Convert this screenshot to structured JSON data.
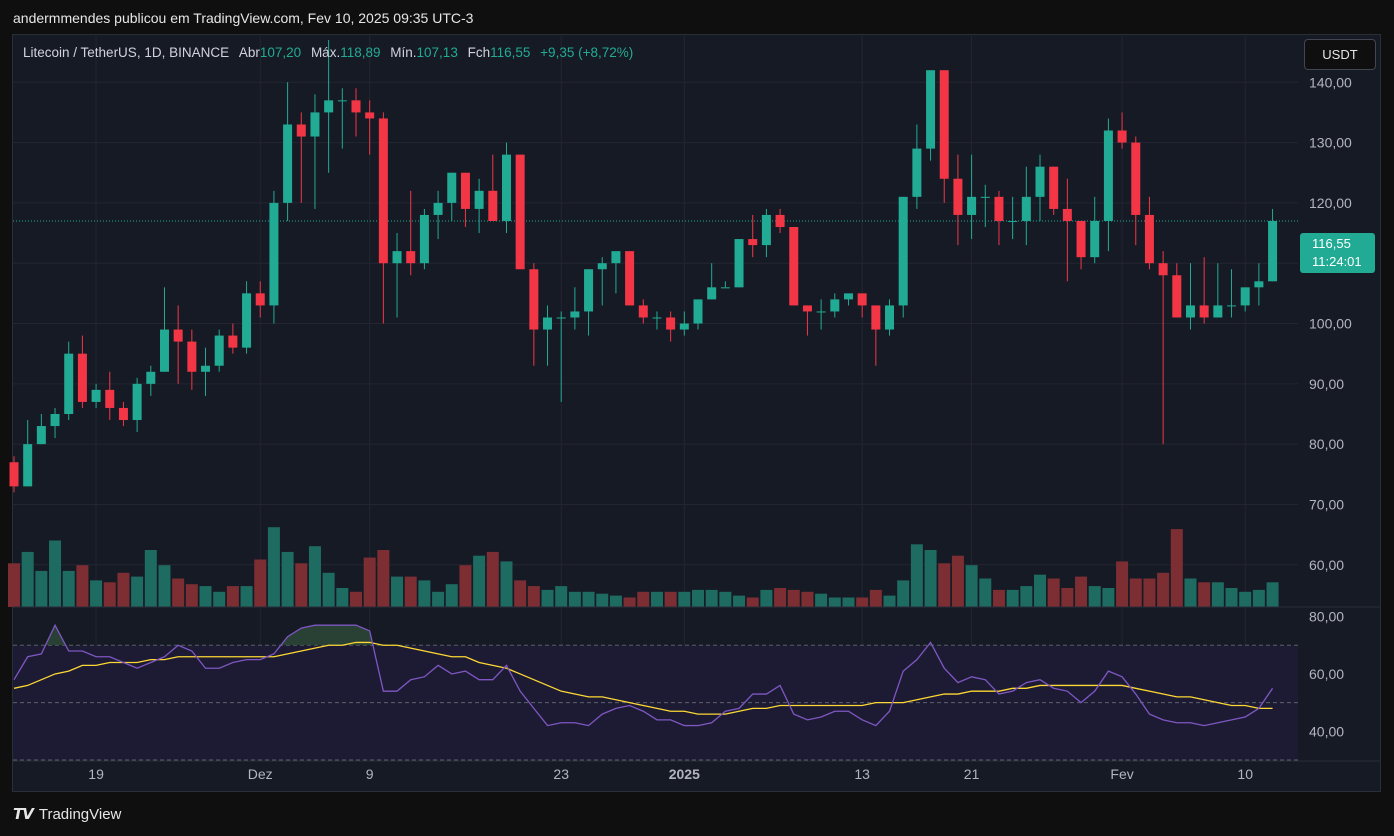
{
  "header": {
    "text": "andermmendes publicou em TradingView.com, Fev 10, 2025 09:35 UTC-3"
  },
  "legend": {
    "symbol": "Litecoin / TetherUS, 1D, BINANCE",
    "open_label": "Abr",
    "open": "107,20",
    "high_label": "Máx.",
    "high": "118,89",
    "low_label": "Mín.",
    "low": "107,13",
    "close_label": "Fch",
    "close": "116,55",
    "change": "+9,35 (+8,72%)"
  },
  "currency_button": "USDT",
  "price_tag": {
    "price": "116,55",
    "countdown": "11:24:01"
  },
  "footer": {
    "brand": "TradingView",
    "logo": "tradingview-logo-icon"
  },
  "colors": {
    "up": "#22ab94",
    "down": "#f23645",
    "up_volume": "#1e6b62",
    "down_volume": "#7d2e33",
    "rsi": "#7e57c2",
    "rsi_ma": "#fdd835"
  },
  "chart_data": {
    "type": "candlestick",
    "price_ylim": [
      53,
      148
    ],
    "price_ticks": [
      "140,00",
      "130,00",
      "120,00",
      "110,00",
      "100,00",
      "90,00",
      "80,00",
      "70,00",
      "60,00"
    ],
    "price_tick_values": [
      140,
      130,
      120,
      110,
      100,
      90,
      80,
      70,
      60
    ],
    "rsi_ylim": [
      30,
      83
    ],
    "rsi_ticks": [
      "80,00",
      "60,00",
      "40,00"
    ],
    "rsi_tick_values": [
      80,
      60,
      40
    ],
    "rsi_bands": [
      70,
      50,
      30
    ],
    "x_labels": [
      {
        "index": 6,
        "text": "19",
        "bold": false
      },
      {
        "index": 18,
        "text": "Dez",
        "bold": false
      },
      {
        "index": 26,
        "text": "9",
        "bold": false
      },
      {
        "index": 40,
        "text": "23",
        "bold": false
      },
      {
        "index": 49,
        "text": "2025",
        "bold": true
      },
      {
        "index": 62,
        "text": "13",
        "bold": false
      },
      {
        "index": 70,
        "text": "21",
        "bold": false
      },
      {
        "index": 81,
        "text": "Fev",
        "bold": false
      },
      {
        "index": 90,
        "text": "10",
        "bold": false
      }
    ],
    "grid": true,
    "candles": [
      [
        77,
        78,
        72,
        73
      ],
      [
        73,
        84,
        73,
        80
      ],
      [
        80,
        85,
        80,
        83
      ],
      [
        83,
        86,
        81,
        85
      ],
      [
        85,
        97,
        84,
        95
      ],
      [
        95,
        98,
        86,
        87
      ],
      [
        87,
        90,
        86,
        89
      ],
      [
        89,
        92,
        84,
        86
      ],
      [
        86,
        87,
        83,
        84
      ],
      [
        84,
        91,
        82,
        90
      ],
      [
        90,
        93,
        88,
        92
      ],
      [
        92,
        106,
        92,
        99
      ],
      [
        99,
        103,
        90,
        97
      ],
      [
        97,
        99,
        89,
        92
      ],
      [
        92,
        96,
        88,
        93
      ],
      [
        93,
        99,
        92,
        98
      ],
      [
        98,
        100,
        95,
        96
      ],
      [
        96,
        107,
        95,
        105
      ],
      [
        105,
        107,
        101,
        103
      ],
      [
        103,
        122,
        100,
        120
      ],
      [
        120,
        140,
        117,
        133
      ],
      [
        133,
        135,
        120,
        131
      ],
      [
        131,
        138,
        119,
        135
      ],
      [
        135,
        147,
        125,
        137
      ],
      [
        137,
        139,
        129,
        137
      ],
      [
        137,
        139,
        131,
        135
      ],
      [
        135,
        137,
        128,
        134
      ],
      [
        134,
        135,
        100,
        110
      ],
      [
        110,
        115,
        101,
        112
      ],
      [
        112,
        122,
        108,
        110
      ],
      [
        110,
        119,
        109,
        118
      ],
      [
        118,
        122,
        114,
        120
      ],
      [
        120,
        125,
        117,
        125
      ],
      [
        125,
        125,
        116,
        119
      ],
      [
        119,
        124,
        115,
        122
      ],
      [
        122,
        128,
        117,
        117
      ],
      [
        117,
        130,
        115,
        128
      ],
      [
        128,
        128,
        109,
        109
      ],
      [
        109,
        110,
        93,
        99
      ],
      [
        99,
        103,
        93,
        101
      ],
      [
        101,
        102,
        87,
        101
      ],
      [
        101,
        106,
        99,
        102
      ],
      [
        102,
        109,
        98,
        109
      ],
      [
        109,
        111,
        103,
        110
      ],
      [
        110,
        111,
        105,
        112
      ],
      [
        112,
        112,
        103,
        103
      ],
      [
        103,
        104,
        100,
        101
      ],
      [
        101,
        102,
        99,
        101
      ],
      [
        101,
        102,
        97,
        99
      ],
      [
        99,
        102,
        98,
        100
      ],
      [
        100,
        103,
        99,
        104
      ],
      [
        104,
        110,
        104,
        106
      ],
      [
        106,
        107,
        106,
        106
      ],
      [
        106,
        113,
        106,
        114
      ],
      [
        114,
        118,
        111,
        113
      ],
      [
        113,
        119,
        111,
        118
      ],
      [
        118,
        119,
        115,
        116
      ],
      [
        116,
        116,
        103,
        103
      ],
      [
        103,
        103,
        98,
        102
      ],
      [
        102,
        104,
        99,
        102
      ],
      [
        102,
        105,
        101,
        104
      ],
      [
        104,
        105,
        103,
        105
      ],
      [
        105,
        105,
        101,
        103
      ],
      [
        103,
        103,
        93,
        99
      ],
      [
        99,
        104,
        98,
        103
      ],
      [
        103,
        121,
        101,
        121
      ],
      [
        121,
        133,
        119,
        129
      ],
      [
        129,
        141,
        127,
        142
      ],
      [
        142,
        140,
        120,
        124
      ],
      [
        124,
        128,
        113,
        118
      ],
      [
        118,
        128,
        114,
        121
      ],
      [
        121,
        123,
        116,
        121
      ],
      [
        121,
        122,
        113,
        117
      ],
      [
        117,
        121,
        114,
        117
      ],
      [
        117,
        126,
        113,
        121
      ],
      [
        121,
        128,
        117,
        126
      ],
      [
        126,
        126,
        118,
        119
      ],
      [
        119,
        124,
        107,
        117
      ],
      [
        117,
        117,
        109,
        111
      ],
      [
        111,
        121,
        110,
        117
      ],
      [
        117,
        134,
        112,
        132
      ],
      [
        132,
        135,
        129,
        130
      ],
      [
        130,
        131,
        113,
        118
      ],
      [
        118,
        121,
        109,
        110
      ],
      [
        110,
        112,
        80,
        108
      ],
      [
        108,
        110,
        101,
        101
      ],
      [
        101,
        110,
        99,
        103
      ],
      [
        103,
        111,
        100,
        101
      ],
      [
        101,
        110,
        101,
        103
      ],
      [
        103,
        109,
        101,
        103
      ],
      [
        103,
        105,
        102,
        106
      ],
      [
        106,
        110,
        103,
        107
      ],
      [
        107,
        119,
        107,
        117
      ]
    ],
    "volumes": [
      11.5,
      14.5,
      9.5,
      17.5,
      9.5,
      11.0,
      7.0,
      6.5,
      9.0,
      8.0,
      15.0,
      11.0,
      7.5,
      6.0,
      5.5,
      4.0,
      5.5,
      5.5,
      12.5,
      21.0,
      14.5,
      11.5,
      16.0,
      9.0,
      5.0,
      4.0,
      13.0,
      15.0,
      8.0,
      8.0,
      7.0,
      4.0,
      6.0,
      11.0,
      13.5,
      14.5,
      12.0,
      7.0,
      5.5,
      4.5,
      5.5,
      4.0,
      4.0,
      3.5,
      3.0,
      2.5,
      4.0,
      4.0,
      4.0,
      4.0,
      4.5,
      4.5,
      4.0,
      3.0,
      2.5,
      4.5,
      5.0,
      4.5,
      4.0,
      3.5,
      2.5,
      2.5,
      2.5,
      4.5,
      3.0,
      7.0,
      16.5,
      15.0,
      11.5,
      13.5,
      11.0,
      7.5,
      4.5,
      4.5,
      5.5,
      8.5,
      7.5,
      5.0,
      8.0,
      5.5,
      5.0,
      12.0,
      7.5,
      7.5,
      9.0,
      20.5,
      7.5,
      6.5,
      6.5,
      5.0,
      4.0,
      4.5,
      6.5
    ],
    "rsi": [
      58,
      66,
      67,
      77,
      68,
      68,
      66,
      66,
      64,
      62,
      64,
      66,
      70,
      68,
      62,
      62,
      64,
      65,
      65,
      67,
      73,
      76,
      77,
      77,
      77,
      77,
      75,
      54,
      54,
      58,
      59,
      63,
      60,
      61,
      58,
      58,
      63,
      54,
      48,
      42,
      43,
      43,
      42,
      46,
      48,
      49,
      47,
      44,
      44,
      42,
      42,
      43,
      47,
      48,
      53,
      53,
      56,
      46,
      44,
      45,
      47,
      47,
      44,
      42,
      47,
      61,
      65,
      71,
      62,
      57,
      59,
      58,
      53,
      54,
      57,
      58,
      55,
      54,
      50,
      54,
      61,
      59,
      53,
      46,
      44,
      43,
      43,
      42,
      43,
      44,
      45,
      48,
      55
    ],
    "rsi_ma": [
      55,
      56,
      58,
      60,
      61,
      63,
      63,
      64,
      64,
      64,
      65,
      65,
      66,
      66,
      66,
      66,
      66,
      66,
      66,
      66,
      67,
      68,
      69,
      70,
      70,
      71,
      71,
      70,
      70,
      69,
      68,
      67,
      66,
      66,
      64,
      63,
      62,
      60,
      58,
      56,
      54,
      53,
      52,
      52,
      51,
      50,
      49,
      48,
      47,
      47,
      46,
      46,
      46,
      47,
      48,
      48,
      49,
      49,
      49,
      49,
      49,
      49,
      49,
      50,
      50,
      50,
      51,
      52,
      53,
      53,
      54,
      54,
      54,
      55,
      55,
      56,
      56,
      56,
      56,
      56,
      56,
      56,
      55,
      54,
      53,
      52,
      52,
      51,
      50,
      49,
      49,
      48,
      48
    ]
  }
}
